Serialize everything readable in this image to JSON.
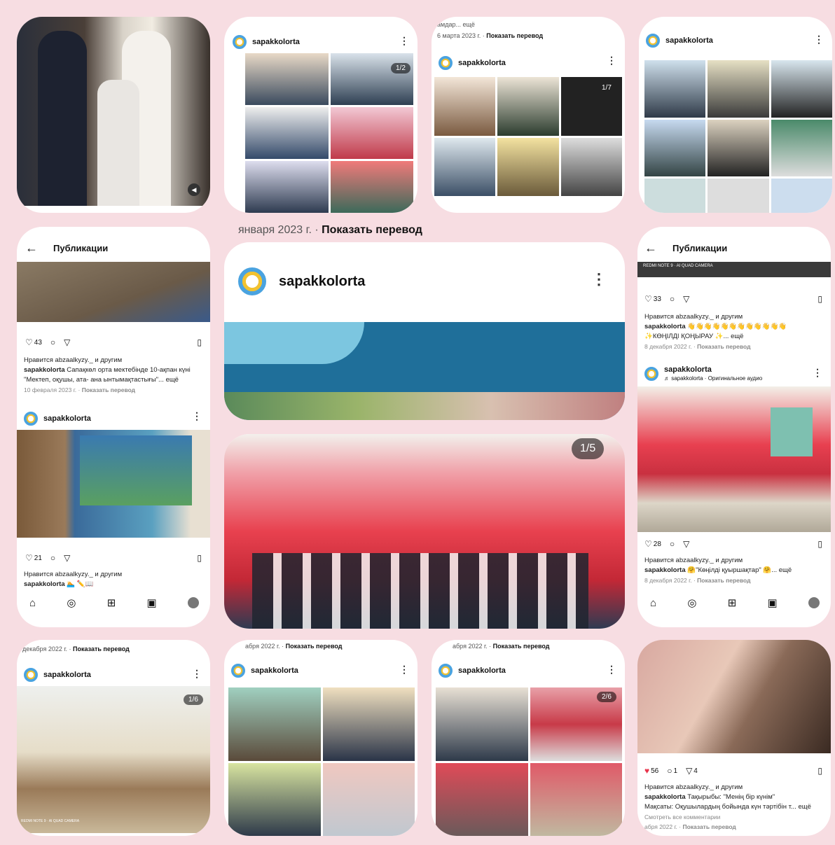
{
  "colors": {
    "bg": "#f7dde2",
    "banner": "#1f6f9a",
    "like": "#e8344b"
  },
  "card2": {
    "user": "sapakkolorta",
    "count": "1/2"
  },
  "card3": {
    "top_text": "амдар... ещё",
    "date": "6 марта 2023 г.",
    "translate": "Показать перевод",
    "user": "sapakkolorta",
    "count": "1/7"
  },
  "card4": {
    "user": "sapakkolorta"
  },
  "card5": {
    "title": "Публикации",
    "likes": "43",
    "liked_by": "Нравится abzaalkyzy._ и другим",
    "user": "sapakkolorta",
    "caption": "Сапақкөл орта мектебінде 10-ақпан күні \"Мектеп, оқушы, ата- ана ынтымақтастығы\"... ещё",
    "date": "10 февраля 2023 г.",
    "translate": "Показать перевод",
    "user2": "sapakkolorta",
    "likes2": "21",
    "liked_by2": "Нравится abzaalkyzy._ и другим",
    "user3": "sapakkolorta",
    "caption3": "🏊 ✏️📖"
  },
  "center": {
    "date": "января 2023 г.",
    "translate": "Показать перевод",
    "user": "sapakkolorta",
    "count": "1/5"
  },
  "card7": {
    "title": "Публикации",
    "camera": "REDMI NOTE 9 · AI QUAD CAMERA",
    "likes": "33",
    "liked_by": "Нравится abzaalkyzy._ и другим",
    "user": "sapakkolorta",
    "caption": "👋👋👋👋👋👋👋👋👋👋👋👋",
    "caption2": "✨КӨҢІЛДІ ҚОҢЫРАУ ✨... ещё",
    "date": "8 декабря 2022 г.",
    "translate": "Показать перевод",
    "user2": "sapakkolorta",
    "audio": "♬ sapakkolorta · Оригинальное аудио",
    "likes2": "28",
    "liked_by2": "Нравится abzaalkyzy._ и другим",
    "user3": "sapakkolorta",
    "caption3": "🤗\"Көңілді қуыршақтар\" 🤗... ещё",
    "date3": "8 декабря 2022 г.",
    "translate3": "Показать перевод"
  },
  "card8": {
    "date": "декабря 2022 г.",
    "translate": "Показать перевод",
    "user": "sapakkolorta",
    "count": "1/6",
    "camera": "REDMI NOTE 9 · AI QUAD CAMERA"
  },
  "card9": {
    "date": "абря 2022 г.",
    "translate": "Показать перевод",
    "user": "sapakkolorta"
  },
  "card10": {
    "date": "абря 2022 г.",
    "translate": "Показать перевод",
    "user": "sapakkolorta",
    "count": "2/6"
  },
  "card11": {
    "likes": "56",
    "comments": "1",
    "shares": "4",
    "liked_by": "Нравится abzaalkyzy._ и другим",
    "user": "sapakkolorta",
    "caption": "Тақырыбы: \"Менің бір күнім\"",
    "caption2": "Мақсаты: Оқушылардың бойында күн тәртібін т... ещё",
    "comments_link": "Смотреть все комментарии",
    "date": "абря 2022 г.",
    "translate": "Показать перевод"
  }
}
